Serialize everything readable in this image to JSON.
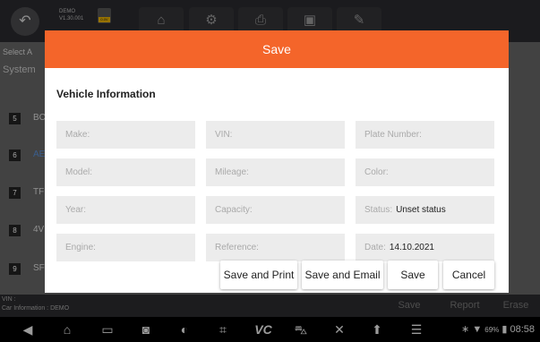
{
  "app": {
    "demo_label_line1": "DEMO",
    "demo_label_line2": "V1.30.001",
    "battery_badge": "0.0V"
  },
  "toolbar_icons": [
    "home-icon",
    "gear-icon",
    "printer-icon",
    "image-icon",
    "edit-icon"
  ],
  "background": {
    "select_text": "Select A",
    "system_text": "System",
    "rows": [
      {
        "num": "5",
        "text": "BC"
      },
      {
        "num": "6",
        "text": "AE"
      },
      {
        "num": "7",
        "text": "TF"
      },
      {
        "num": "8",
        "text": "4V"
      },
      {
        "num": "9",
        "text": "SF"
      }
    ],
    "vin_label": "VIN :",
    "car_info": "Car Information : DEMO",
    "footer_buttons": {
      "save": "Save",
      "report": "Report",
      "erase": "Erase"
    }
  },
  "dialog": {
    "title": "Save",
    "section_title": "Vehicle Information",
    "fields": {
      "make": {
        "label": "Make:",
        "value": ""
      },
      "vin": {
        "label": "VIN:",
        "value": ""
      },
      "plate": {
        "label": "Plate Number:",
        "value": ""
      },
      "model": {
        "label": "Model:",
        "value": ""
      },
      "mileage": {
        "label": "Mileage:",
        "value": ""
      },
      "color": {
        "label": "Color:",
        "value": ""
      },
      "year": {
        "label": "Year:",
        "value": ""
      },
      "capacity": {
        "label": "Capacity:",
        "value": ""
      },
      "status": {
        "label": "Status:",
        "value": "Unset status"
      },
      "engine": {
        "label": "Engine:",
        "value": ""
      },
      "reference": {
        "label": "Reference:",
        "value": ""
      },
      "date": {
        "label": "Date:",
        "value": "14.10.2021"
      }
    },
    "buttons": {
      "save_print": "Save and Print",
      "save_email": "Save and Email",
      "save": "Save",
      "cancel": "Cancel"
    }
  },
  "navbar": {
    "icons": [
      "back-icon",
      "home-icon",
      "recent-apps-icon",
      "camera-icon",
      "browser-icon",
      "screenshot-icon",
      "vci-icon",
      "car-icon",
      "tools-icon",
      "upload-icon",
      "menu-icon"
    ],
    "vci_label": "VC",
    "battery": "69%",
    "time": "08:58"
  },
  "colors": {
    "accent": "#f4652a",
    "field_bg": "#ececec",
    "dialog_bg": "#ffffff"
  }
}
